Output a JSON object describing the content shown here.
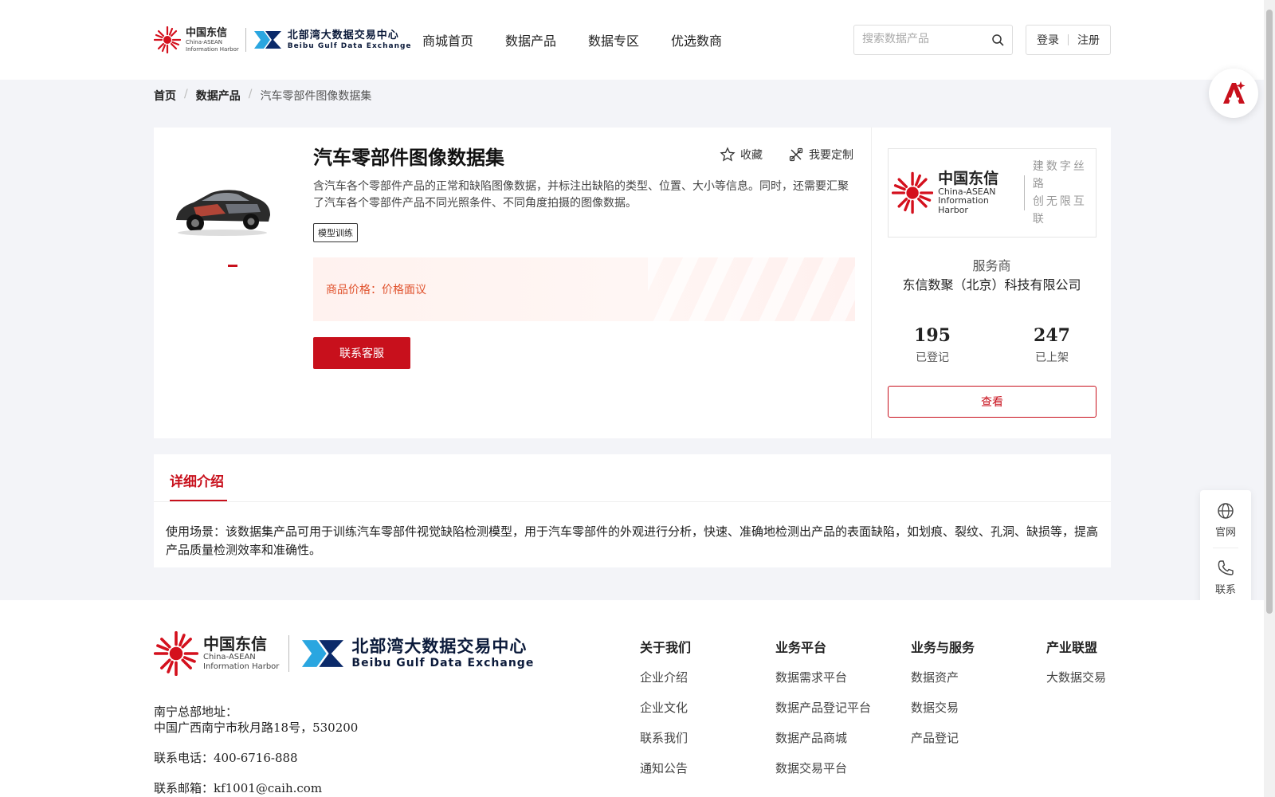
{
  "header": {
    "logo_cn": "中国东信",
    "logo_en1": "China-ASEAN",
    "logo_en2": "Information Harbor",
    "logo_bg_cn": "北部湾大数据交易中心",
    "logo_bg_en": "Beibu Gulf Data Exchange",
    "nav": [
      "商城首页",
      "数据产品",
      "数据专区",
      "优选数商"
    ],
    "search_placeholder": "搜索数据产品",
    "login": "登录",
    "register": "注册"
  },
  "breadcrumb": [
    "首页",
    "数据产品",
    "汽车零部件图像数据集"
  ],
  "product": {
    "title": "汽车零部件图像数据集",
    "favorite": "收藏",
    "customize": "我要定制",
    "description": "含汽车各个零部件产品的正常和缺陷图像数据，并标注出缺陷的类型、位置、大小等信息。同时，还需要汇聚了汽车各个零部件产品不同光照条件、不同角度拍摄的图像数据。",
    "tag": "模型训练",
    "price_label": "商品价格：",
    "price_value": "价格面议",
    "contact_button": "联系客服"
  },
  "provider": {
    "logo_cn": "中国东信",
    "logo_en1": "China-ASEAN",
    "logo_en2": "Information Harbor",
    "slogan1": "建数字丝路",
    "slogan2": "创无限互联",
    "label": "服务商",
    "name": "东信数聚（北京）科技有限公司",
    "registered_count": "195",
    "registered_label": "已登记",
    "listed_count": "247",
    "listed_label": "已上架",
    "view_button": "查看"
  },
  "detail": {
    "tab": "详细介绍",
    "body": "使用场景：该数据集产品可用于训练汽车零部件视觉缺陷检测模型，用于汽车零部件的外观进行分析，快速、准确地检测出产品的表面缺陷，如划痕、裂纹、孔洞、缺损等，提高产品质量检测效率和准确性。"
  },
  "side_float": {
    "website": "官网",
    "contact": "联系"
  },
  "footer": {
    "address_label": "南宁总部地址：",
    "address": "中国广西南宁市秋月路18号，530200",
    "phone": "联系电话：400-6716-888",
    "email": "联系邮箱：kf1001@caih.com",
    "columns": [
      {
        "title": "关于我们",
        "items": [
          "企业介绍",
          "企业文化",
          "联系我们",
          "通知公告"
        ]
      },
      {
        "title": "业务平台",
        "items": [
          "数据需求平台",
          "数据产品登记平台",
          "数据产品商城",
          "数据交易平台"
        ]
      },
      {
        "title": "业务与服务",
        "items": [
          "数据资产",
          "数据交易",
          "产品登记"
        ]
      },
      {
        "title": "产业联盟",
        "items": [
          "大数据交易"
        ]
      }
    ]
  },
  "colors": {
    "brand_red": "#c8101c",
    "price_orange": "#e0522d"
  }
}
